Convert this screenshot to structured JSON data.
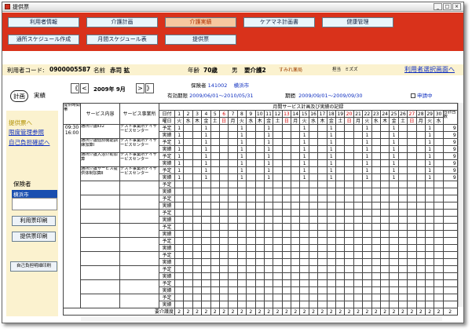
{
  "window": {
    "title": "提供票"
  },
  "menu_row1": [
    "利用者情報",
    "介護計画",
    "介護実績",
    "ケアマネ計画書",
    "健康管理"
  ],
  "menu_row2": [
    "通所スケジュール作成",
    "月間スケジュール表",
    "提供票"
  ],
  "patient": {
    "code_label": "利用者コード:",
    "code": "0900005587",
    "name_label": "名前",
    "name": "赤司 拡",
    "age_label": "年齢",
    "age": "70歳",
    "sex": "男",
    "care_level": "要介護2",
    "office": "すみれ薬局",
    "staff_label": "担当",
    "staff": "ミズズ",
    "select_link": "利用者選択画面へ"
  },
  "tabs": [
    "計画",
    "実績"
  ],
  "side_links": [
    "提供票へ",
    "限度管理参照",
    "自己負担確認へ"
  ],
  "insurer_label": "保険者",
  "insurer_value": "横浜市",
  "buttons": {
    "usage_print": "利用票印刷",
    "provision_print": "提供票印刷",
    "self_pay_print": "自己負担明細印刷"
  },
  "period": {
    "month": "2009年 9月",
    "nav_first": "《",
    "nav_prev": "<",
    "nav_next": ">",
    "nav_last": "》"
  },
  "insurance": {
    "insurer_label": "保険者",
    "insurer_no": "141002",
    "insurer_name": "横浜市",
    "valid_label": "有効期限",
    "valid_range": "2009/06/01～2010/05/31",
    "period_label": "期間",
    "period_range": "2009/09/01～2009/09/30",
    "applying_label": "申請中"
  },
  "table": {
    "header_title": "月間サービス計画及び実績の記録",
    "col_time": "提供時間帯",
    "col_service": "サービス内容",
    "col_provider": "サービス事業所",
    "day_label": "日付",
    "weekday_label": "曜日",
    "total_label": "合計回数",
    "days": [
      "1",
      "2",
      "3",
      "4",
      "5",
      "6",
      "7",
      "8",
      "9",
      "10",
      "11",
      "12",
      "13",
      "14",
      "15",
      "16",
      "17",
      "18",
      "19",
      "20",
      "21",
      "22",
      "23",
      "24",
      "25",
      "26",
      "27",
      "28",
      "29",
      "30"
    ],
    "weekdays": [
      "火",
      "水",
      "木",
      "金",
      "土",
      "日",
      "月",
      "火",
      "水",
      "木",
      "金",
      "土",
      "日",
      "月",
      "火",
      "水",
      "木",
      "金",
      "土",
      "日",
      "月",
      "火",
      "水",
      "木",
      "金",
      "土",
      "日",
      "月",
      "火",
      "水"
    ],
    "time_slot": "09:30\n16:00",
    "plan_label": "予定",
    "actual_label": "実績",
    "services": [
      {
        "name": "通所介護Ⅱ32",
        "provider": "テスト事業所デイサービスセンター"
      },
      {
        "name": "通所介護個別機能訓練加算Ⅰ",
        "provider": "テスト事業所デイサービスセンター"
      },
      {
        "name": "通所介護入浴介助加算",
        "provider": "テスト事業所デイサービスセンター"
      },
      {
        "name": "通所介護サービス提供体制加算Ⅱ",
        "provider": "テスト事業所デイサービスセンター"
      }
    ],
    "mark": "1",
    "scheduled_days": [
      "1",
      "4",
      "8",
      "11",
      "15",
      "18",
      "22",
      "25",
      "29"
    ],
    "row_totals": [
      "9",
      "9",
      "9",
      "9",
      "9",
      "9",
      "9",
      "9"
    ],
    "footer_label": "要介護度",
    "footer_value": "2",
    "footer_total": "2"
  },
  "colors": {
    "menu_bg": "#d9321b",
    "info_bg": "#fbf2cf",
    "link": "#1030c0",
    "sunday": "#d00000"
  }
}
